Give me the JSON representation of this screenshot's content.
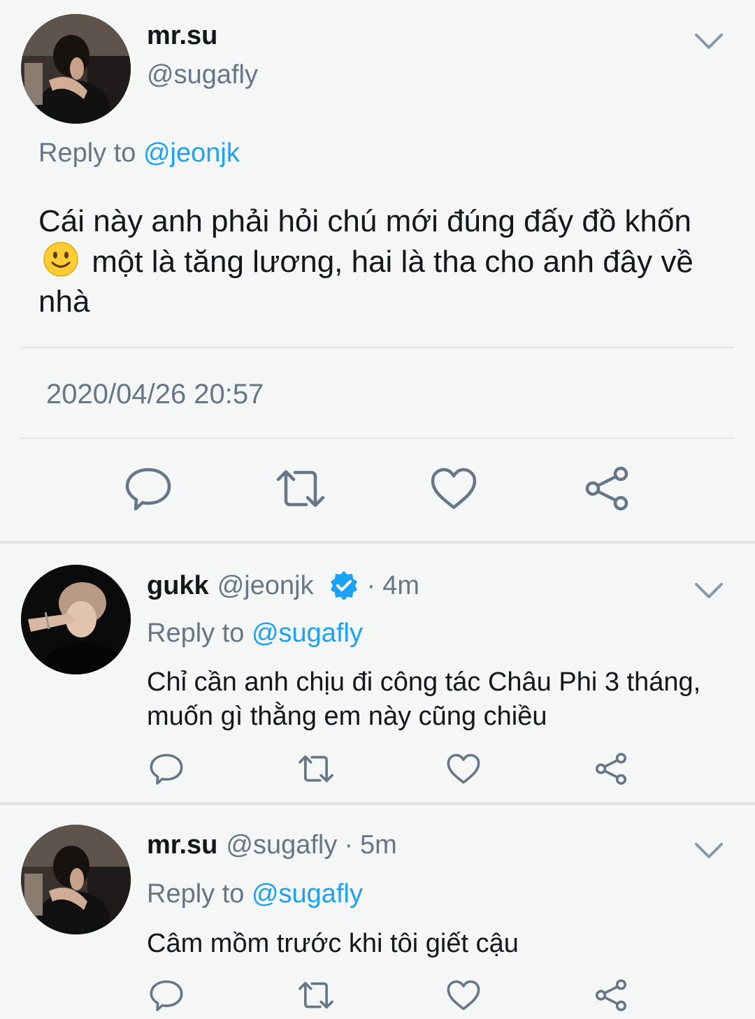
{
  "main_tweet": {
    "name": "mr.su",
    "handle": "@sugafly",
    "reply_prefix": "Reply to ",
    "reply_mention": "@jeonjk",
    "text_part1": "Cái này anh phải hỏi chú mới đúng đấy đồ khốn",
    "emoji": "slightly-smiling-face",
    "text_part2": "một là tăng lương, hai là tha cho anh đây về nhà",
    "timestamp": "2020/04/26 20:57",
    "icons": [
      "reply-icon",
      "retweet-icon",
      "like-icon",
      "share-icon",
      "chevron-down-icon"
    ]
  },
  "replies": [
    {
      "name": "gukk",
      "handle": "@jeonjk",
      "verified": true,
      "separator": "·",
      "time": "4m",
      "reply_prefix": "Reply to ",
      "reply_mention": "@sugafly",
      "text": "Chỉ cần anh chịu đi công tác Châu Phi 3 tháng, muốn gì thằng em này cũng chiều"
    },
    {
      "name": "mr.su",
      "handle": "@sugafly",
      "verified": false,
      "separator": "·",
      "time": "5m",
      "reply_prefix": "Reply to ",
      "reply_mention": "@sugafly",
      "text": "Câm mồm trước khi tôi giết cậu"
    }
  ],
  "colors": {
    "background": "#f5f6f6",
    "text": "#14171a",
    "secondary": "#657786",
    "accent": "#1da1f2",
    "icon": "#657786"
  }
}
